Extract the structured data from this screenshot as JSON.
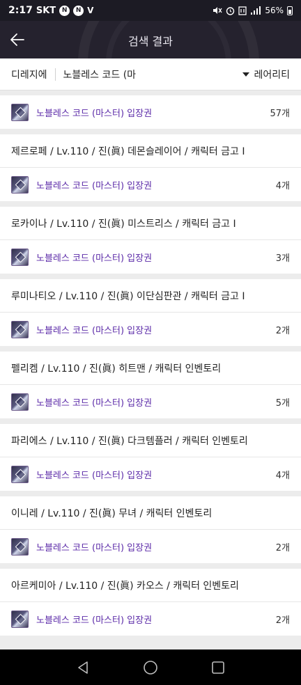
{
  "status_bar": {
    "time": "2:17",
    "carrier": "SKT",
    "badges": [
      "N",
      "N"
    ],
    "extra": "V",
    "battery": "56%",
    "icons": [
      "mute-icon",
      "alarm-icon",
      "lte-icon",
      "signal-icon",
      "battery-icon"
    ]
  },
  "app_bar": {
    "title": "검색 결과",
    "back_icon": "back-arrow-icon"
  },
  "filter": {
    "server": "디레지에",
    "query": "노블레스 코드 (마",
    "sort": "레어리티"
  },
  "results": [
    {
      "character": "",
      "item": "노블레스 코드 (마스터) 입장권",
      "count": "57개"
    },
    {
      "character": "제르로페 / Lv.110 / 진(眞) 데몬슬레이어 / 캐릭터 금고 I",
      "item": "노블레스 코드 (마스터) 입장권",
      "count": "4개"
    },
    {
      "character": "로카이나 / Lv.110 / 진(眞) 미스트리스 / 캐릭터 금고 I",
      "item": "노블레스 코드 (마스터) 입장권",
      "count": "3개"
    },
    {
      "character": "루미나티오 / Lv.110 / 진(眞) 이단심판관 / 캐릭터 금고 I",
      "item": "노블레스 코드 (마스터) 입장권",
      "count": "2개"
    },
    {
      "character": "펠리켐 / Lv.110 / 진(眞) 히트맨 / 캐릭터 인벤토리",
      "item": "노블레스 코드 (마스터) 입장권",
      "count": "5개"
    },
    {
      "character": "파리에스 / Lv.110 / 진(眞) 다크템플러 / 캐릭터 인벤토리",
      "item": "노블레스 코드 (마스터) 입장권",
      "count": "4개"
    },
    {
      "character": "이니레 / Lv.110 / 진(眞) 무녀 / 캐릭터 인벤토리",
      "item": "노블레스 코드 (마스터) 입장권",
      "count": "2개"
    },
    {
      "character": "아르케미아 / Lv.110 / 진(眞) 카오스 / 캐릭터 인벤토리",
      "item": "노블레스 코드 (마스터) 입장권",
      "count": "2개"
    }
  ],
  "nav_bar": {
    "buttons": [
      "back-triangle-icon",
      "home-circle-icon",
      "recents-square-icon"
    ]
  },
  "colors": {
    "header_bg": "#25222e",
    "item_name": "#5b2aa8",
    "page_bg": "#ececec"
  }
}
